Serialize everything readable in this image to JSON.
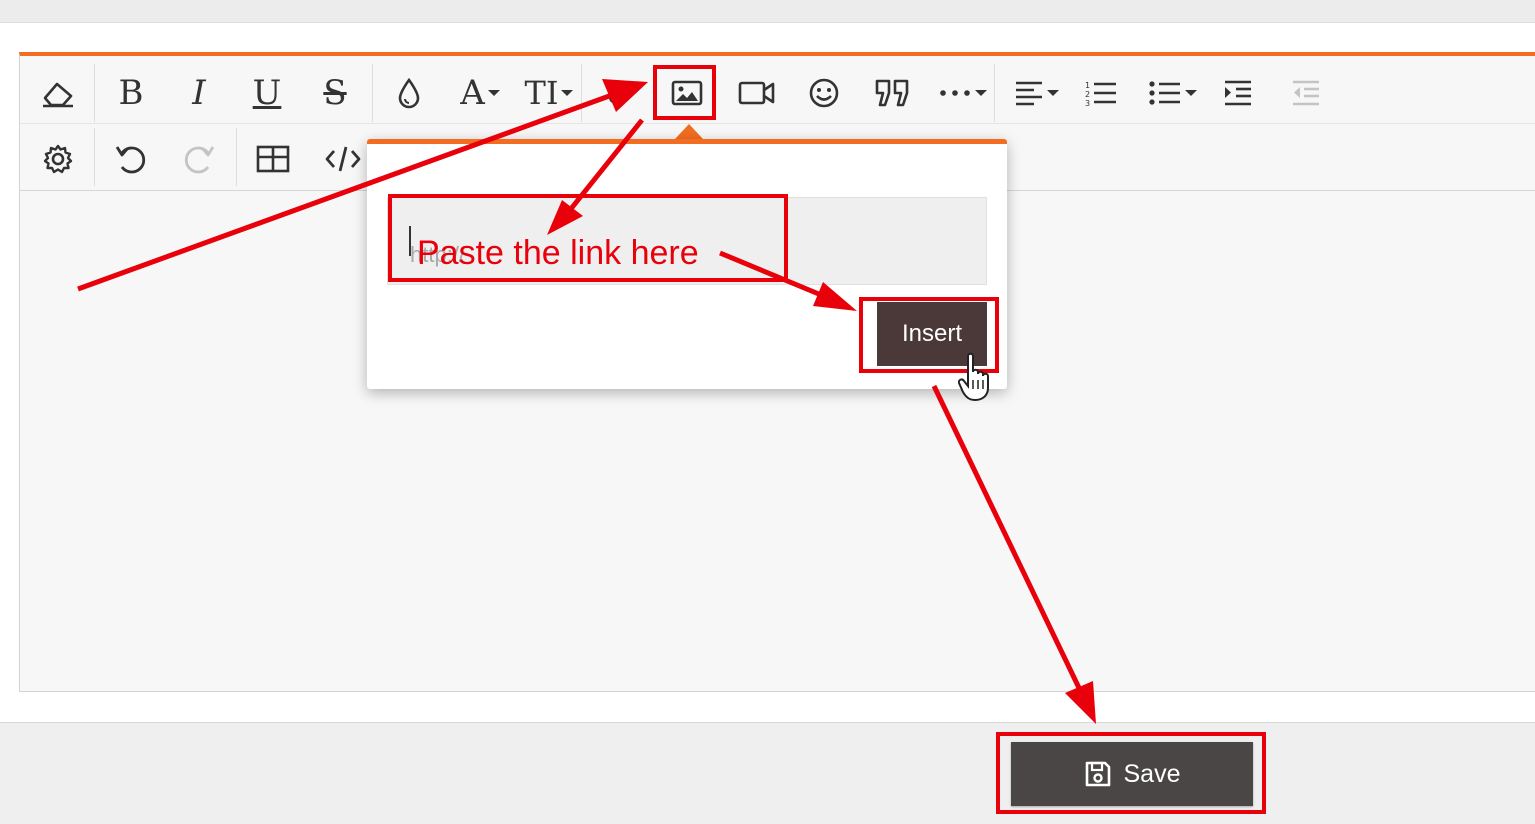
{
  "toolbar": {
    "row1": [
      {
        "name": "eraser-icon",
        "label": "Remove format"
      },
      {
        "name": "bold-icon",
        "glyph": "B"
      },
      {
        "name": "italic-icon",
        "glyph": "I"
      },
      {
        "name": "underline-icon",
        "glyph": "U"
      },
      {
        "name": "strikethrough-icon",
        "glyph": "S"
      },
      {
        "name": "color-drop-icon"
      },
      {
        "name": "font-family-icon",
        "glyph": "A"
      },
      {
        "name": "font-size-icon",
        "glyph": "TI"
      },
      {
        "name": "link-icon"
      },
      {
        "name": "image-icon"
      },
      {
        "name": "video-icon"
      },
      {
        "name": "smiley-icon"
      },
      {
        "name": "quote-icon"
      },
      {
        "name": "more-icon"
      },
      {
        "name": "align-icon"
      },
      {
        "name": "ordered-list-icon"
      },
      {
        "name": "unordered-list-icon"
      },
      {
        "name": "indent-icon"
      },
      {
        "name": "outdent-icon"
      }
    ],
    "row2": [
      {
        "name": "gear-icon"
      },
      {
        "name": "undo-icon"
      },
      {
        "name": "redo-icon"
      },
      {
        "name": "table-icon"
      },
      {
        "name": "code-icon"
      }
    ]
  },
  "image_popup": {
    "url_placeholder": "http://",
    "insert_label": "Insert"
  },
  "footer": {
    "save_label": "Save"
  },
  "annotations": {
    "paste_hint": "Paste the link here",
    "color": "#e8000b"
  },
  "colors": {
    "accent": "#f26d21",
    "insert_bg": "#4b3838",
    "save_bg": "#4a4646"
  }
}
